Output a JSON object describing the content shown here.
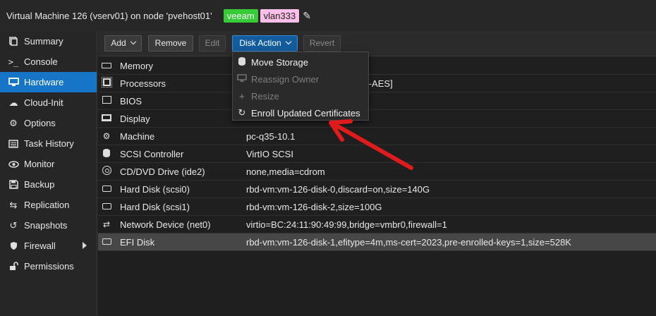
{
  "window": {
    "title": "Virtual Machine 126 (vserv01) on node 'pvehost01'",
    "tags": [
      {
        "label": "veeam",
        "color": "#37cc37"
      },
      {
        "label": "vlan333",
        "color": "#ffbfe8"
      }
    ],
    "edit_icon": "pencil-icon"
  },
  "sidebar": {
    "items": [
      {
        "label": "Summary",
        "icon": "book-icon"
      },
      {
        "label": "Console",
        "icon": "terminal-icon"
      },
      {
        "label": "Hardware",
        "icon": "desktop-icon",
        "active": true
      },
      {
        "label": "Cloud-Init",
        "icon": "cloud-icon"
      },
      {
        "label": "Options",
        "icon": "gear-icon"
      },
      {
        "label": "Task History",
        "icon": "list-icon"
      },
      {
        "label": "Monitor",
        "icon": "eye-icon"
      },
      {
        "label": "Backup",
        "icon": "floppy-icon"
      },
      {
        "label": "Replication",
        "icon": "retweet-icon"
      },
      {
        "label": "Snapshots",
        "icon": "history-icon"
      },
      {
        "label": "Firewall",
        "icon": "shield-icon",
        "has_submenu": true
      },
      {
        "label": "Permissions",
        "icon": "unlock-icon"
      }
    ]
  },
  "toolbar": {
    "add_label": "Add",
    "remove_label": "Remove",
    "edit_label": "Edit",
    "disk_action_label": "Disk Action",
    "revert_label": "Revert"
  },
  "menu": {
    "items": [
      {
        "label": "Move Storage",
        "icon": "database-icon",
        "disabled": false
      },
      {
        "label": "Reassign Owner",
        "icon": "desktop-icon",
        "disabled": true
      },
      {
        "label": "Resize",
        "icon": "plus-icon",
        "disabled": true
      },
      {
        "label": "Enroll Updated Certificates",
        "icon": "refresh-icon",
        "disabled": false
      }
    ]
  },
  "hardware": {
    "rows": [
      {
        "name": "Memory",
        "value": "",
        "icon": "memory-icon"
      },
      {
        "name": "Processors",
        "value": "v2-AES]",
        "icon": "cpu-icon"
      },
      {
        "name": "BIOS",
        "value": "",
        "icon": "bios-icon"
      },
      {
        "name": "Display",
        "value": "",
        "icon": "monitor-icon"
      },
      {
        "name": "Machine",
        "value": "pc-q35-10.1",
        "icon": "cogs-icon"
      },
      {
        "name": "SCSI Controller",
        "value": "VirtIO SCSI",
        "icon": "database-icon"
      },
      {
        "name": "CD/DVD Drive (ide2)",
        "value": "none,media=cdrom",
        "icon": "cdrom-icon"
      },
      {
        "name": "Hard Disk (scsi0)",
        "value": "rbd-vm:vm-126-disk-0,discard=on,size=140G",
        "icon": "harddisk-icon"
      },
      {
        "name": "Hard Disk (scsi1)",
        "value": "rbd-vm:vm-126-disk-2,size=100G",
        "icon": "harddisk-icon"
      },
      {
        "name": "Network Device (net0)",
        "value": "virtio=BC:24:11:90:49:99,bridge=vmbr0,firewall=1",
        "icon": "exchange-icon"
      },
      {
        "name": "EFI Disk",
        "value": "rbd-vm:vm-126-disk-1,efitype=4m,ms-cert=2023,pre-enrolled-keys=1,size=528K",
        "icon": "harddisk-icon",
        "selected": true
      }
    ]
  },
  "annotation": {
    "arrow_color": "#e01b1b",
    "icon": "red-arrow-icon"
  }
}
